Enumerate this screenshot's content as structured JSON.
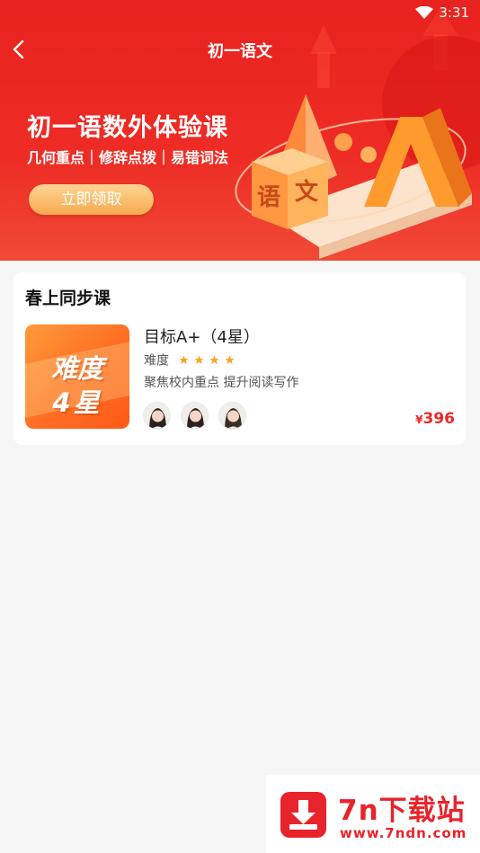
{
  "status_bar": {
    "time": "3:31"
  },
  "nav": {
    "title": "初一语文"
  },
  "banner": {
    "title": "初一语数外体验课",
    "subtitle": "几何重点｜修辞点拨｜易错词法",
    "cta_label": "立即领取"
  },
  "section": {
    "title": "春上同步课"
  },
  "course": {
    "cover_line1": "难度",
    "cover_line2": "4星",
    "name": "目标A+（4星）",
    "difficulty_label": "难度",
    "difficulty_stars": 4,
    "description": "聚焦校内重点 提升阅读写作",
    "teachers_count": 3,
    "price_symbol": "¥",
    "price": "396"
  },
  "watermark": {
    "name": "7n下载站",
    "url": "www.7ndn.com"
  },
  "colors": {
    "banner_red": "#e8221e",
    "cta_gold": "#f6a94f",
    "price_red": "#e62a2a",
    "cover_orange": "#ff6d22",
    "star_gold": "#f5a623"
  },
  "icons": [
    "wifi-icon",
    "back-icon",
    "star-icon",
    "avatar",
    "download-icon"
  ]
}
